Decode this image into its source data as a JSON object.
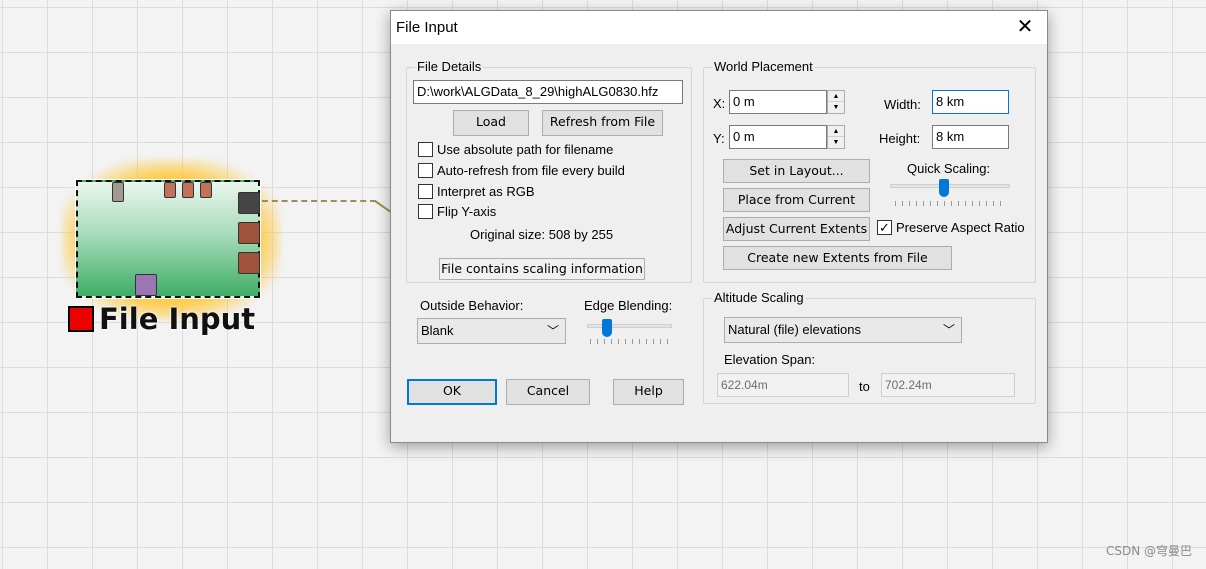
{
  "node": {
    "label": "File Input"
  },
  "dialog": {
    "title": "File Input",
    "close_icon": "close-icon",
    "file_details": {
      "group_title": "File Details",
      "path": "D:\\work\\ALGData_8_29\\highALG0830.hfz",
      "load_label": "Load",
      "refresh_label": "Refresh from File",
      "options": [
        {
          "label": "Use absolute path for filename",
          "checked": false
        },
        {
          "label": "Auto-refresh from file every build",
          "checked": false
        },
        {
          "label": "Interpret as RGB",
          "checked": false
        },
        {
          "label": "Flip Y-axis",
          "checked": false
        }
      ],
      "original_size": "Original size: 508 by 255",
      "scaling_info_label": "File contains scaling information"
    },
    "world_placement": {
      "group_title": "World Placement",
      "x_label": "X:",
      "x_value": "0 m",
      "y_label": "Y:",
      "y_value": "0 m",
      "width_label": "Width:",
      "width_value": "8 km",
      "height_label": "Height:",
      "height_value": "8 km",
      "set_in_layout_label": "Set in Layout...",
      "place_from_current_label": "Place from Current",
      "adjust_extents_label": "Adjust Current Extents",
      "quick_scaling_label": "Quick Scaling:",
      "quick_scaling_level": 0.45,
      "preserve_aspect_label": "Preserve Aspect Ratio",
      "preserve_aspect_checked": true,
      "create_extents_label": "Create new Extents from File"
    },
    "outside_behavior": {
      "label": "Outside Behavior:",
      "selected": "Blank"
    },
    "edge_blending": {
      "label": "Edge Blending:",
      "level": 0.24
    },
    "altitude_scaling": {
      "group_title": "Altitude Scaling",
      "mode_selected": "Natural (file) elevations",
      "elevation_span_label": "Elevation Span:",
      "span_from": "622.04m",
      "to_label": "to",
      "span_to": "702.24m"
    },
    "buttons": {
      "ok": "OK",
      "cancel": "Cancel",
      "help": "Help"
    }
  },
  "watermark": "CSDN @穹曼巴",
  "colors": {
    "accent": "#0078d7",
    "node_gradient_bottom": "#3fae67",
    "node_glow": "#ffc428",
    "node_label_square": "#ee0000"
  }
}
